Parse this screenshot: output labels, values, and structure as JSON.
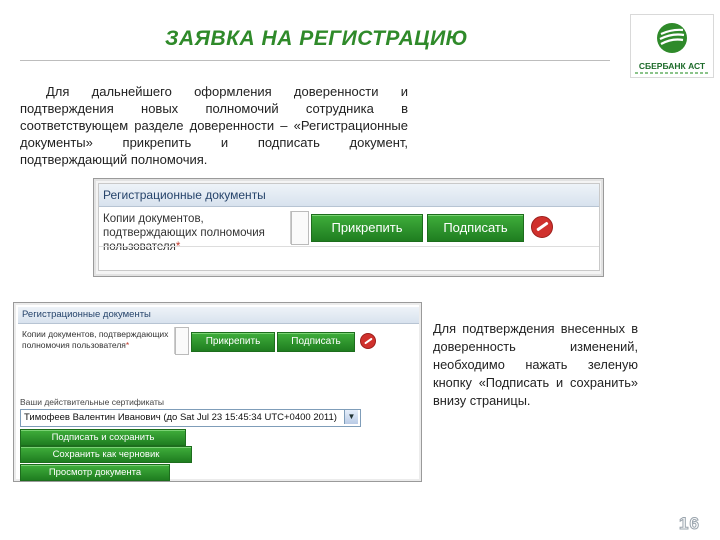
{
  "title": "ЗАЯВКА НА РЕГИСТРАЦИЮ",
  "logo": {
    "text": "СБЕРБАНК АСТ",
    "icon": "sberbank-logo-icon",
    "color": "#2f8a2a"
  },
  "paragraph_1": "Для дальнейшего оформления доверенности и подтверждения новых полномочий сотрудника в соответствующем разделе доверенности – «Регистрационные документы» прикрепить и подписать документ, подтверждающий полномочия.",
  "paragraph_2": "Для подтверждения внесенных в доверенность изменений, необходимо нажать зеленую кнопку «Подписать и сохранить» внизу страницы.",
  "screenshot_1": {
    "section_title": "Регистрационные документы",
    "field_label": "Копии документов, подтверждающих полномочия пользователя",
    "required_mark": "*",
    "attach_button": "Прикрепить",
    "sign_button": "Подписать"
  },
  "screenshot_2": {
    "section_title": "Регистрационные документы",
    "field_label": "Копии документов, подтверждающих полномочия пользователя",
    "required_mark": "*",
    "attach_button": "Прикрепить",
    "sign_button": "Подписать",
    "certificates_label": "Ваши действительные сертификаты",
    "certificate_selected": "Тимофеев Валентин Иванович (до Sat Jul 23 15:45:34 UTC+0400 2011)",
    "sign_and_save_button": "Подписать и сохранить",
    "save_draft_button": "Сохранить как черновик",
    "preview_button": "Просмотр документа"
  },
  "page_number": "16",
  "colors": {
    "accent_green": "#2f8a2a",
    "button_green": "#1f7d20",
    "header_blue": "#26446b"
  }
}
